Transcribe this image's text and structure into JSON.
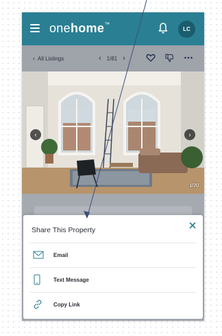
{
  "header": {
    "logo_prefix": "one",
    "logo_emphasis": "home",
    "logo_suffix": "™",
    "avatar_initials": "LC",
    "accent_color": "#2a7f93"
  },
  "listing_bar": {
    "back_label": "All Listings",
    "pager_text": "1/81",
    "icons": [
      "chevron-left-icon",
      "chevron-right-icon",
      "heart-icon",
      "thumbs-down-icon",
      "more-icon"
    ]
  },
  "photo": {
    "counter": "1/20"
  },
  "share_sheet": {
    "title": "Share This Property",
    "options": [
      {
        "label": "Email",
        "icon": "envelope-icon"
      },
      {
        "label": "Text Message",
        "icon": "phone-icon"
      },
      {
        "label": "Copy Link",
        "icon": "link-icon"
      }
    ]
  }
}
